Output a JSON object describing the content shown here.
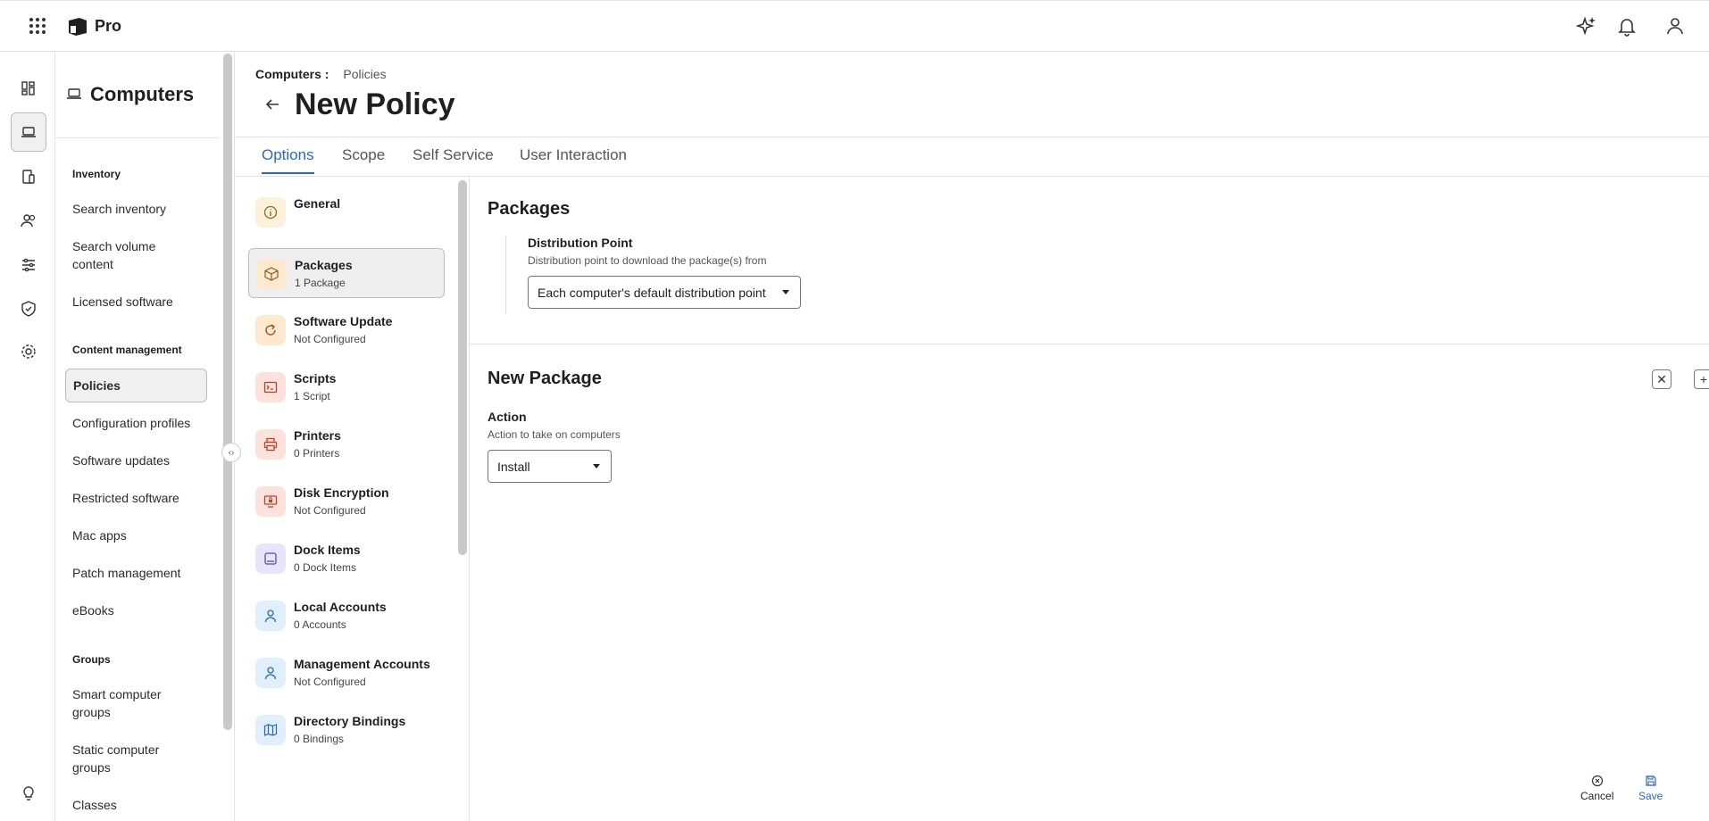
{
  "app": {
    "brand": "Pro"
  },
  "nav": {
    "title": "Computers",
    "sections": [
      {
        "label": "Inventory",
        "items": [
          "Search inventory",
          "Search volume content",
          "Licensed software"
        ]
      },
      {
        "label": "Content management",
        "items": [
          "Policies",
          "Configuration profiles",
          "Software updates",
          "Restricted software",
          "Mac apps",
          "Patch management",
          "eBooks"
        ]
      },
      {
        "label": "Groups",
        "items": [
          "Smart computer groups",
          "Static computer groups",
          "Classes"
        ]
      }
    ],
    "active": "Policies"
  },
  "breadcrumb": {
    "parent": "Computers",
    "separator": ":",
    "current": "Policies"
  },
  "page": {
    "title": "New Policy"
  },
  "tabs": [
    {
      "label": "Options",
      "active": true
    },
    {
      "label": "Scope",
      "active": false
    },
    {
      "label": "Self Service",
      "active": false
    },
    {
      "label": "User Interaction",
      "active": false
    }
  ],
  "options_list": [
    {
      "name": "General",
      "desc": "",
      "icon": "info-icon",
      "color": "#fdf1dc"
    },
    {
      "name": "Packages",
      "desc": "1 Package",
      "icon": "package-icon",
      "color": "#fde9cf",
      "active": true
    },
    {
      "name": "Software Update",
      "desc": "Not Configured",
      "icon": "update-icon",
      "color": "#fde9cf"
    },
    {
      "name": "Scripts",
      "desc": "1 Script",
      "icon": "terminal-icon",
      "color": "#fde2dc"
    },
    {
      "name": "Printers",
      "desc": "0 Printers",
      "icon": "printer-icon",
      "color": "#fde2dc"
    },
    {
      "name": "Disk Encryption",
      "desc": "Not Configured",
      "icon": "disk-encryption-icon",
      "color": "#fde2dc"
    },
    {
      "name": "Dock Items",
      "desc": "0 Dock Items",
      "icon": "dock-icon",
      "color": "#e8e4fb"
    },
    {
      "name": "Local Accounts",
      "desc": "0 Accounts",
      "icon": "user-icon",
      "color": "#e1eefb"
    },
    {
      "name": "Management Accounts",
      "desc": "Not Configured",
      "icon": "user-icon",
      "color": "#e1eefb"
    },
    {
      "name": "Directory Bindings",
      "desc": "0 Bindings",
      "icon": "map-icon",
      "color": "#e1eefb"
    }
  ],
  "packages": {
    "heading": "Packages",
    "distribution_point": {
      "label": "Distribution Point",
      "help": "Distribution point to download the package(s) from",
      "value": "Each computer's default distribution point"
    }
  },
  "new_package": {
    "heading": "New Package",
    "action": {
      "label": "Action",
      "help": "Action to take on computers",
      "value": "Install"
    }
  },
  "footer": {
    "cancel": "Cancel",
    "save": "Save"
  },
  "colors": {
    "accent": "#2d66c8"
  }
}
